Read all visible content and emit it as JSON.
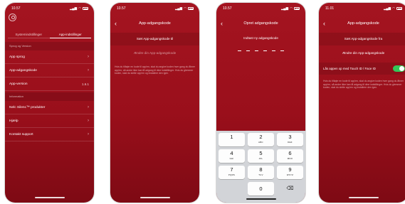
{
  "screens": [
    {
      "status": {
        "time": "10.57"
      },
      "tabs": [
        "Systemindstillinger",
        "App-indstillinger"
      ],
      "active_tab": 1,
      "sections": {
        "general": "Sprog og Version",
        "info": "Information"
      },
      "rows": {
        "language": "App sprog",
        "passcode": "App-adgangskode",
        "version": "App-version",
        "version_value": "1.6.1",
        "products": "Nelc Silenc™ produkter",
        "help": "Hjælp",
        "support": "Kontakt support"
      }
    },
    {
      "status": {
        "time": "10.57"
      },
      "title": "App-adgangskode",
      "set_label": "Sæt App-adgangskode til",
      "change_label": "Ændre din App-adgangskode",
      "description": "Hvis du tilføjer en kode til app'en, skal du angive koden hver gang du åbner app'en, så andre ikke kan få adgang til dine indstillinger. Hvis du glemmer koden, skal du slette app'en og installere den igen."
    },
    {
      "status": {
        "time": "10.57"
      },
      "title": "Opret adgangskode",
      "instruction": "Indtast ny adgangskode",
      "keys": [
        {
          "digit": "1",
          "letters": ""
        },
        {
          "digit": "2",
          "letters": "ABC"
        },
        {
          "digit": "3",
          "letters": "DEF"
        },
        {
          "digit": "4",
          "letters": "GHI"
        },
        {
          "digit": "5",
          "letters": "JKL"
        },
        {
          "digit": "6",
          "letters": "MNO"
        },
        {
          "digit": "7",
          "letters": "PQRS"
        },
        {
          "digit": "8",
          "letters": "TUV"
        },
        {
          "digit": "9",
          "letters": "WXYZ"
        },
        {
          "digit": "0",
          "letters": ""
        }
      ],
      "delete_glyph": "⌫"
    },
    {
      "status": {
        "time": "11.01"
      },
      "title": "App-adgangskode",
      "set_label": "Sæt App-adgangskode fra",
      "change_label": "Ændre din App-adgangskode",
      "toggle_label": "Lås appen op med Touch ID / Face ID",
      "toggle_on": true,
      "description": "Hvis du tilføjer en kode til app'en, skal du angive koden hver gang du åbner app'en, så andre ikke kan få adgang til dine indstillinger. Hvis du glemmer koden, skal du slette app'en og installere den igen."
    }
  ],
  "colors": {
    "accent": "#a41420",
    "toggle_on": "#34c759",
    "keypad_bg": "#d2d4d8"
  },
  "icons": {
    "back": "chevron-left-icon",
    "row_chevron": "chevron-right-icon",
    "profile": "user-icon",
    "delete": "backspace-icon"
  }
}
